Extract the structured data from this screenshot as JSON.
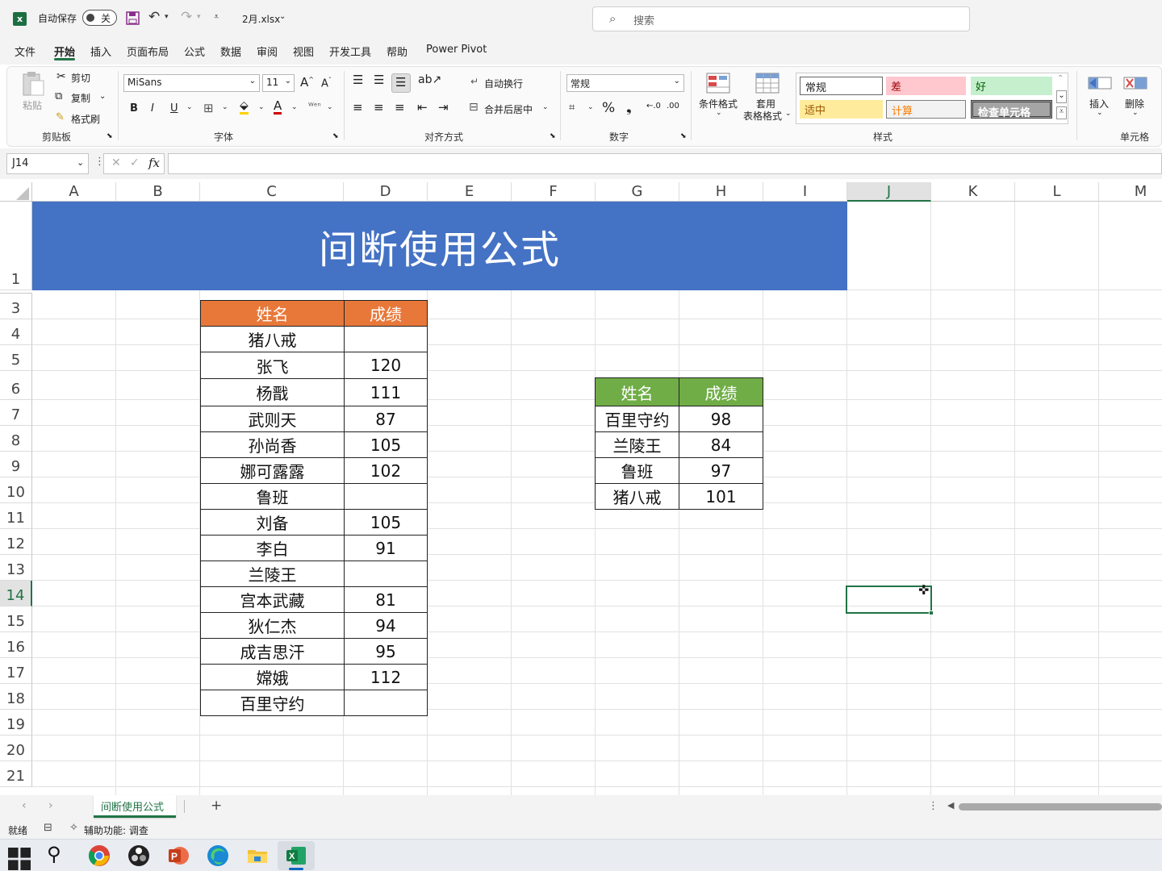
{
  "titlebar": {
    "autosave_label": "自动保存",
    "autosave_state": "关",
    "filename": "2月.xlsx",
    "search_placeholder": "搜索"
  },
  "menu": [
    "文件",
    "开始",
    "插入",
    "页面布局",
    "公式",
    "数据",
    "审阅",
    "视图",
    "开发工具",
    "帮助",
    "Power Pivot"
  ],
  "ribbon": {
    "clipboard": {
      "paste": "粘贴",
      "cut": "剪切",
      "copy": "复制",
      "format_painter": "格式刷",
      "group": "剪贴板"
    },
    "font": {
      "name": "MiSans",
      "size": "11",
      "group": "字体"
    },
    "alignment": {
      "wrap": "自动换行",
      "merge": "合并后居中",
      "group": "对齐方式"
    },
    "number": {
      "format": "常规",
      "group": "数字"
    },
    "styles": {
      "cond_format": "条件格式",
      "table_format_1": "套用",
      "table_format_2": "表格格式",
      "normal": "常规",
      "bad": "差",
      "good": "好",
      "neutral": "适中",
      "calc": "计算",
      "check": "检查单元格",
      "group": "样式"
    },
    "cells": {
      "insert": "插入",
      "delete": "删除",
      "group": "单元格"
    }
  },
  "formula": {
    "namebox": "J14",
    "fx": "fx",
    "value": ""
  },
  "columns": [
    "A",
    "B",
    "C",
    "D",
    "E",
    "F",
    "G",
    "H",
    "I",
    "J",
    "K",
    "L",
    "M"
  ],
  "rows": [
    "1",
    "3",
    "4",
    "5",
    "6",
    "7",
    "8",
    "9",
    "10",
    "11",
    "12",
    "13",
    "14",
    "15",
    "16",
    "17",
    "18",
    "19",
    "20",
    "21"
  ],
  "sheet_title": "间断使用公式",
  "table1": {
    "headers": [
      "姓名",
      "成绩"
    ],
    "rows": [
      [
        "猪八戒",
        ""
      ],
      [
        "张飞",
        "120"
      ],
      [
        "杨戬",
        "111"
      ],
      [
        "武则天",
        "87"
      ],
      [
        "孙尚香",
        "105"
      ],
      [
        "娜可露露",
        "102"
      ],
      [
        "鲁班",
        ""
      ],
      [
        "刘备",
        "105"
      ],
      [
        "李白",
        "91"
      ],
      [
        "兰陵王",
        ""
      ],
      [
        "宫本武藏",
        "81"
      ],
      [
        "狄仁杰",
        "94"
      ],
      [
        "成吉思汗",
        "95"
      ],
      [
        "嫦娥",
        "112"
      ],
      [
        "百里守约",
        ""
      ]
    ]
  },
  "table2": {
    "headers": [
      "姓名",
      "成绩"
    ],
    "rows": [
      [
        "百里守约",
        "98"
      ],
      [
        "兰陵王",
        "84"
      ],
      [
        "鲁班",
        "97"
      ],
      [
        "猪八戒",
        "101"
      ]
    ]
  },
  "sheet_tab": "间断使用公式",
  "status": {
    "ready": "就绪",
    "accessibility": "辅助功能: 调查"
  },
  "colors": {
    "title_bg": "#4472c4",
    "header_orange": "#e8783a",
    "header_green": "#70ad47",
    "excel_green": "#217346"
  }
}
